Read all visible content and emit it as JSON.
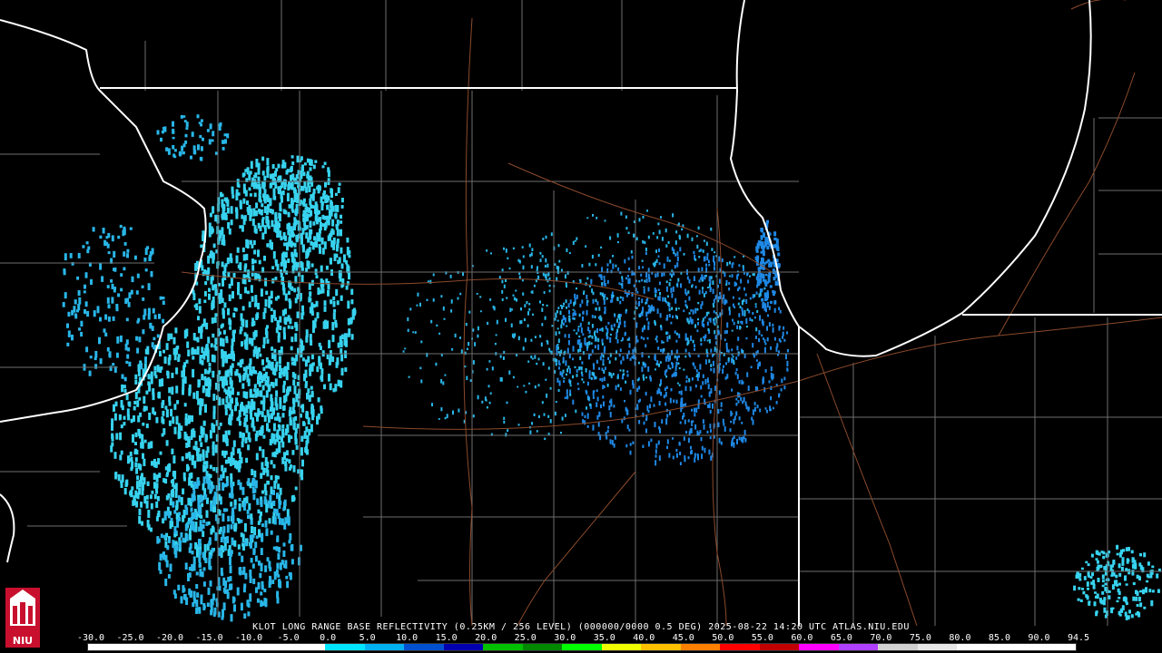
{
  "caption": "KLOT LONG RANGE BASE REFLECTIVITY (0.25KM / 256 LEVEL) (000000/0000 0.5 DEG) 2025-08-22 14:20 UTC  ATLAS.NIU.EDU",
  "scale": {
    "labels": [
      "-30.0",
      "-25.0",
      "-20.0",
      "-15.0",
      "-10.0",
      "-5.0",
      "0.0",
      "5.0",
      "10.0",
      "15.0",
      "20.0",
      "25.0",
      "30.0",
      "35.0",
      "40.0",
      "45.0",
      "50.0",
      "55.0",
      "60.0",
      "65.0",
      "70.0",
      "75.0",
      "80.0",
      "85.0",
      "90.0",
      "94.5"
    ],
    "colors": [
      "#ffffff",
      "#ffffff",
      "#ffffff",
      "#ffffff",
      "#ffffff",
      "#ffffff",
      "#00e5ff",
      "#00b0f0",
      "#0050d0",
      "#0000b0",
      "#00c000",
      "#008800",
      "#00ff00",
      "#f0ff00",
      "#ffc000",
      "#ff8000",
      "#ff0000",
      "#c00000",
      "#ff00ff",
      "#b040ff",
      "#d0d0d0",
      "#e8e8e8",
      "#ffffff",
      "#ffffff",
      "#ffffff"
    ]
  },
  "logo": {
    "text": "NIU",
    "color": "#c8102e"
  },
  "map_colors": {
    "state": "#ffffff",
    "county": "#7a7a7a",
    "highway": "#8b4a2b",
    "echo_light": "#29b6e8",
    "echo_mid": "#1e88e5",
    "echo_cyan": "#37d3ef"
  }
}
